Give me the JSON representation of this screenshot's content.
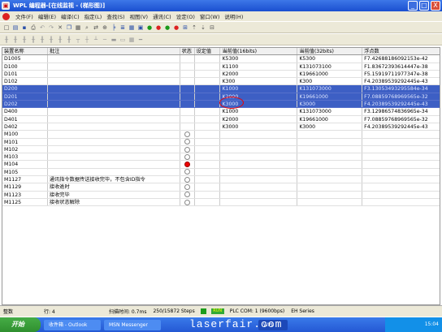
{
  "titlebar": {
    "title": "WPL 编程器-[在线监视 - (梯形图)]",
    "min": "_",
    "max": "□",
    "close": "X"
  },
  "menubar": {
    "items": [
      "文件(F)",
      "编辑(E)",
      "编译(C)",
      "指定(L)",
      "查找(S)",
      "视图(V)",
      "通讯(C)",
      "设定(O)",
      "窗口(W)",
      "说明(H)"
    ]
  },
  "toolbar1": {
    "icons": [
      "new-icon",
      "open-icon",
      "save-icon",
      "print-icon",
      "undo-icon",
      "redo-icon",
      "cut-icon",
      "copy-icon",
      "paste-icon",
      "find-icon",
      "replace-icon",
      "zoom-icon",
      "ladder-icon",
      "list-icon",
      "table-icon",
      "monitor-icon",
      "run-icon",
      "stop-icon",
      "set-icon",
      "reset-icon",
      "force-icon",
      "upload-icon",
      "download-icon",
      "compare-icon"
    ]
  },
  "toolbar2": {
    "icons": [
      "contact-no-icon",
      "contact-nc-icon",
      "contact-p-icon",
      "contact-n-icon",
      "coil-icon",
      "set-coil-icon",
      "reset-coil-icon",
      "func-icon",
      "line-h-icon",
      "line-v-icon",
      "delete-line-icon",
      "insert-row-icon",
      "insert-col-icon",
      "comment-icon",
      "grid-icon",
      "gap-icon"
    ]
  },
  "table": {
    "headers": [
      "装置名称",
      "批注",
      "状态",
      "设定值",
      "当前值(16bits)",
      "当前值(32bits)",
      "浮点数"
    ],
    "rows": [
      {
        "device": "D1005",
        "comment": "",
        "state": "",
        "setv": "",
        "v16": "K5300",
        "v32": "K5300",
        "float": "F7.42688186092153e-42",
        "selected": false
      },
      {
        "device": "D100",
        "comment": "",
        "state": "",
        "setv": "",
        "v16": "K1100",
        "v32": "K131073100",
        "float": "F1.83672393614447e-38",
        "selected": false
      },
      {
        "device": "D101",
        "comment": "",
        "state": "",
        "setv": "",
        "v16": "K2000",
        "v32": "K19661000",
        "float": "F5.15919711977347e-38",
        "selected": false
      },
      {
        "device": "D102",
        "comment": "",
        "state": "",
        "setv": "",
        "v16": "K300",
        "v32": "K300",
        "float": "F4.20389539292445e-43",
        "selected": false
      },
      {
        "device": "D200",
        "comment": "",
        "state": "",
        "setv": "",
        "v16": "K1000",
        "v32": "K131073000",
        "float": "F3.13053493295584e-34",
        "selected": true
      },
      {
        "device": "D201",
        "comment": "",
        "state": "",
        "setv": "",
        "v16": "K2000",
        "v32": "K19661000",
        "float": "F7.08859768969565e-32",
        "selected": true
      },
      {
        "device": "D202",
        "comment": "",
        "state": "",
        "setv": "",
        "v16": "K3000",
        "v32": "K3000",
        "float": "F4.20389539292445e-43",
        "selected": true
      },
      {
        "device": "D400",
        "comment": "",
        "state": "",
        "setv": "",
        "v16": "K1000",
        "v32": "K131073000",
        "float": "F3.12986574836965e-34",
        "selected": false
      },
      {
        "device": "D401",
        "comment": "",
        "state": "",
        "setv": "",
        "v16": "K2000",
        "v32": "K19661000",
        "float": "F7.08859768969565e-32",
        "selected": false
      },
      {
        "device": "D402",
        "comment": "",
        "state": "",
        "setv": "",
        "v16": "K3000",
        "v32": "K3000",
        "float": "F4.20389539292445e-43",
        "selected": false
      },
      {
        "device": "M100",
        "comment": "",
        "state": "off",
        "setv": "",
        "v16": "",
        "v32": "",
        "float": "",
        "selected": false
      },
      {
        "device": "M101",
        "comment": "",
        "state": "off",
        "setv": "",
        "v16": "",
        "v32": "",
        "float": "",
        "selected": false
      },
      {
        "device": "M102",
        "comment": "",
        "state": "off",
        "setv": "",
        "v16": "",
        "v32": "",
        "float": "",
        "selected": false
      },
      {
        "device": "M103",
        "comment": "",
        "state": "off",
        "setv": "",
        "v16": "",
        "v32": "",
        "float": "",
        "selected": false
      },
      {
        "device": "M104",
        "comment": "",
        "state": "on",
        "setv": "",
        "v16": "",
        "v32": "",
        "float": "",
        "selected": false
      },
      {
        "device": "M105",
        "comment": "",
        "state": "off",
        "setv": "",
        "v16": "",
        "v32": "",
        "float": "",
        "selected": false
      },
      {
        "device": "M1127",
        "comment": "通讯指令数据传送接收完毕，不包含ID指令",
        "state": "off",
        "setv": "",
        "v16": "",
        "v32": "",
        "float": "",
        "selected": false
      },
      {
        "device": "M1129",
        "comment": "接收逾时",
        "state": "off",
        "setv": "",
        "v16": "",
        "v32": "",
        "float": "",
        "selected": false
      },
      {
        "device": "M1123",
        "comment": "接收完毕",
        "state": "off",
        "setv": "",
        "v16": "",
        "v32": "",
        "float": "",
        "selected": false
      },
      {
        "device": "M1125",
        "comment": "接收状态解除",
        "state": "off",
        "setv": "",
        "v16": "",
        "v32": "",
        "float": "",
        "selected": false
      }
    ]
  },
  "statusbar": {
    "mode": "整数",
    "row": "行: 4",
    "scan": "扫描时间: 0.7ms",
    "steps": "250/15872 Steps",
    "run": "RUN",
    "comm": "PLC COM: 1 (9600bps)",
    "series": "EH Series"
  },
  "taskbar": {
    "start": "开始",
    "tasks": [
      "收件箱 - Outlook",
      "MSN Messenger",
      "WPL"
    ],
    "watermark": "laserfair.com",
    "clock": "15:04"
  }
}
